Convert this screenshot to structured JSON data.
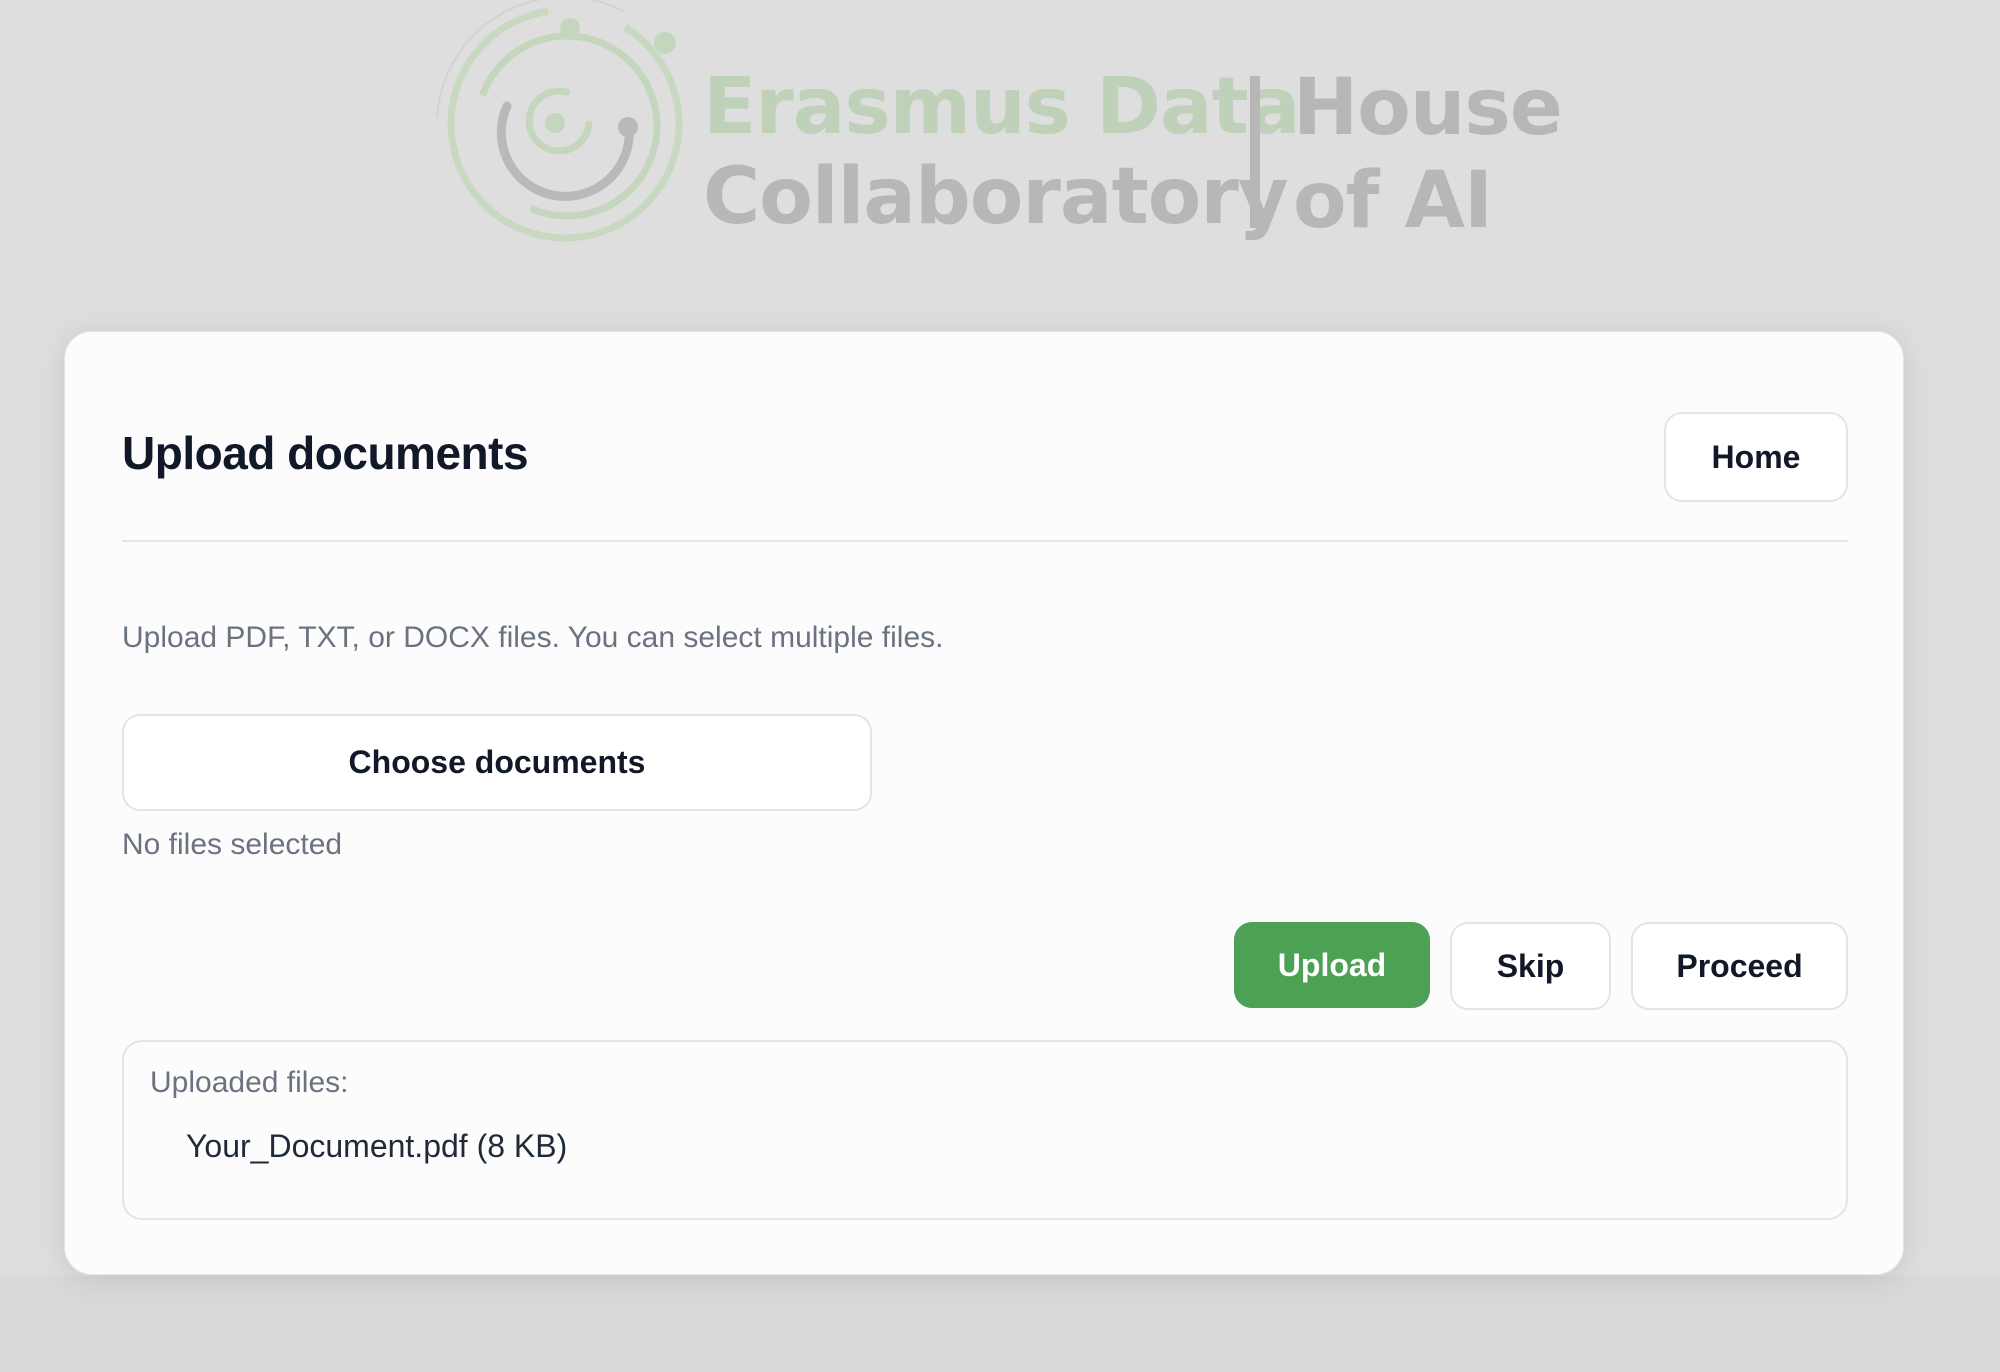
{
  "header": {
    "logo": {
      "line1": "Erasmus Data",
      "line2": "Collaboratory",
      "secondary_line1": "House",
      "secondary_line2": "of AI",
      "colors": {
        "green": "#bfd1b8",
        "gray": "#b7b7b7"
      }
    }
  },
  "card": {
    "title": "Upload documents",
    "home_label": "Home",
    "instructions": "Upload PDF, TXT, or DOCX files. You can select multiple files.",
    "choose_label": "Choose documents",
    "file_status": "No files selected",
    "actions": {
      "upload_label": "Upload",
      "skip_label": "Skip",
      "proceed_label": "Proceed"
    },
    "uploaded": {
      "heading": "Uploaded files:",
      "files": [
        {
          "display": "Your_Document.pdf (8 KB)"
        }
      ]
    }
  },
  "colors": {
    "background": "#dedede",
    "card": "#fcfcfc",
    "primary": "#4ca154",
    "title": "#111827",
    "muted_text": "#6b7280",
    "border": "#e4e4e7"
  }
}
